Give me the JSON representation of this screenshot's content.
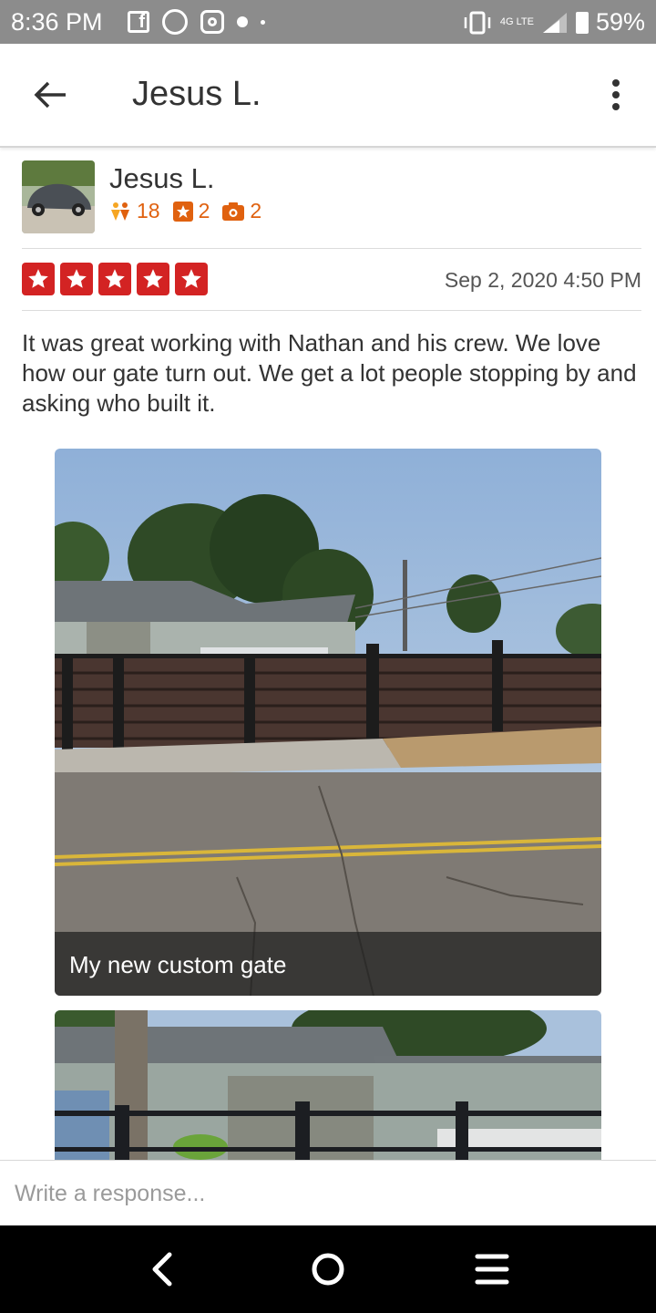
{
  "status_bar": {
    "time": "8:36 PM",
    "network": "4G LTE",
    "battery": "59%",
    "app_icons": [
      "facebook-icon",
      "whatsapp-icon",
      "instagram-icon",
      "message-dot-icon",
      "notification-dot-icon"
    ]
  },
  "header": {
    "title": "Jesus L.",
    "back_icon": "arrow-left-icon",
    "menu_icon": "more-vertical-icon"
  },
  "reviewer": {
    "name": "Jesus L.",
    "friends": "18",
    "reviews": "2",
    "photos": "2"
  },
  "rating": {
    "stars": 5,
    "max": 5,
    "color": "#d32323"
  },
  "review": {
    "date": "Sep 2, 2020 4:50 PM",
    "text": "It was great working with Nathan and his crew. We love how our gate  turn out. We get a lot people stopping by and asking who built it."
  },
  "photos": [
    {
      "caption": "My new custom gate"
    },
    {
      "caption": ""
    }
  ],
  "response": {
    "placeholder": "Write a response..."
  },
  "nav": {
    "back": "back-icon",
    "home": "home-icon",
    "menu": "menu-icon"
  },
  "colors": {
    "accent": "#d32323",
    "stats": "#e0610f",
    "status_bar": "#8c8c8c"
  }
}
